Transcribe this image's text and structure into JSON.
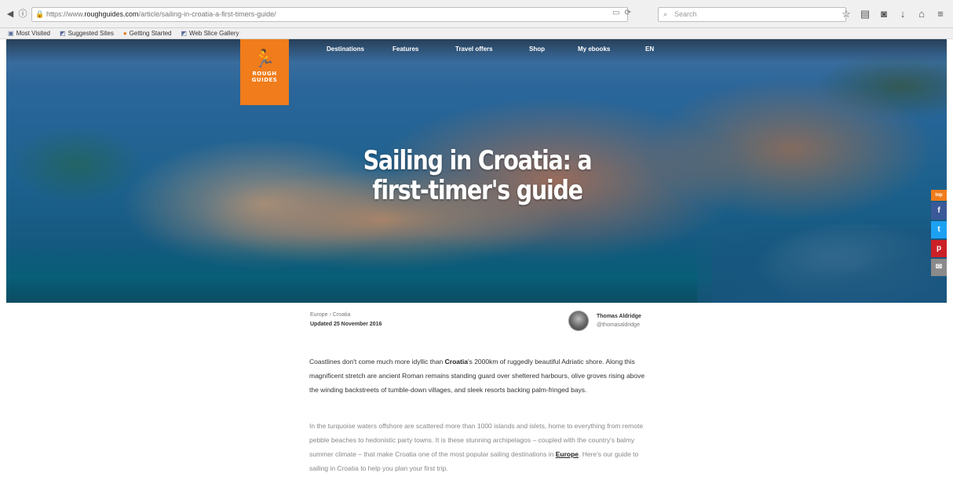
{
  "browser": {
    "url_prefix": "https://www.",
    "url_domain": "roughguides.com",
    "url_path": "/article/sailing-in-croatia-a-first-timers-guide/",
    "search_placeholder": "Search",
    "bookmarks": [
      {
        "label": "Most Visited",
        "icon": "bookmark-icon"
      },
      {
        "label": "Suggested Sites",
        "icon": "bookmark-icon"
      },
      {
        "label": "Getting Started",
        "icon": "firefox-icon"
      },
      {
        "label": "Web Slice Gallery",
        "icon": "bookmark-icon"
      }
    ]
  },
  "site": {
    "logo_line1": "ROUGH",
    "logo_line2": "GUIDES",
    "nav": [
      "Destinations",
      "Features",
      "Travel offers",
      "Shop",
      "My ebooks",
      "EN"
    ]
  },
  "article": {
    "title": "Sailing in Croatia: a first-timer's guide",
    "breadcrumb": "Europe › Croatia",
    "updated": "Updated 25 November 2016",
    "author_name": "Thomas Aldridge",
    "author_handle": "@thomasaldridge",
    "p1_before": "Coastlines don't come much more idyllic than ",
    "p1_link": "Croatia",
    "p1_after": "'s 2000km of ruggedly beautiful Adriatic shore. Along this magnificent stretch are ancient Roman remains standing guard over sheltered harbours, olive groves rising above the winding backstreets of tumble-down villages, and sleek resorts backing palm-fringed bays.",
    "p2_before": "In the turquoise waters offshore are scattered more than 1000 islands and islets, home to everything from remote pebble beaches to hedonistic party towns. It is these stunning archipelagos – coupled with the country's balmy summer climate – that make Croatia one of the most popular sailing destinations in ",
    "p2_link": "Europe",
    "p2_after": ". Here's our guide to sailing in Croatia to help you plan your first trip."
  },
  "share": [
    "top",
    "f",
    "t",
    "p",
    "✉"
  ]
}
